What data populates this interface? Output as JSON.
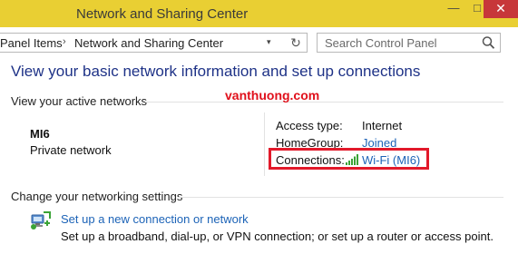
{
  "window": {
    "title": "Network and Sharing Center",
    "minimize_glyph": "—",
    "maximize_glyph": "□",
    "close_glyph": "✕"
  },
  "address": {
    "crumbs": [
      "Panel Items",
      "Network and Sharing Center"
    ],
    "separator": "›",
    "dropdown_glyph": "▾",
    "refresh_glyph": "↻",
    "search_placeholder": "Search Control Panel"
  },
  "main": {
    "heading": "View your basic network information and set up connections",
    "active_networks_label": "View your active networks",
    "watermark": "vanthuong.com",
    "network": {
      "name": "MI6",
      "type": "Private network",
      "access_type_label": "Access type:",
      "access_type_value": "Internet",
      "homegroup_label": "HomeGroup:",
      "homegroup_value": "Joined",
      "connections_label": "Connections:",
      "connections_value": "Wi-Fi (MI6)"
    },
    "change_settings_label": "Change your networking settings",
    "task": {
      "link": "Set up a new connection or network",
      "description": "Set up a broadband, dial-up, or VPN connection; or set up a router or access point."
    }
  },
  "colors": {
    "titlebar": "#e9cf33",
    "close_button": "#c7373a",
    "heading": "#1e3287",
    "link": "#1c63b7",
    "highlight_box": "#e2192a",
    "watermark": "#e0101b",
    "wifi_bars": "#3aa336"
  },
  "icons": [
    "search-icon",
    "wifi-signal-icon",
    "new-connection-icon",
    "refresh-icon",
    "chevron-down-icon"
  ]
}
